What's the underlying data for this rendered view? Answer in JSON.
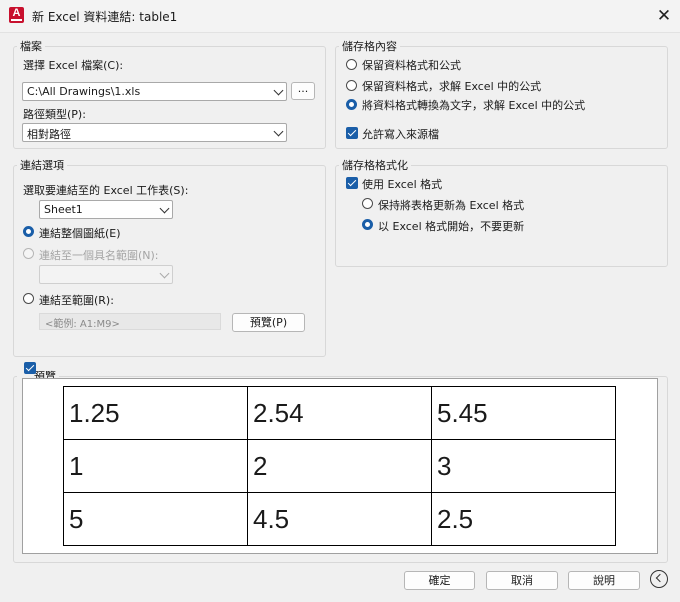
{
  "window": {
    "title": "新 Excel 資料連結: table1",
    "app_icon_letter": "A"
  },
  "file_group": {
    "legend": "檔案",
    "select_label": "選擇 Excel 檔案(C):",
    "file_value": "C:\\All Drawings\\1.xls",
    "browse_label": "...",
    "path_type_label": "路徑類型(P):",
    "path_type_value": "相對路徑"
  },
  "link_group": {
    "legend": "連結選項",
    "sheet_label": "選取要連結至的 Excel 工作表(S):",
    "sheet_value": "Sheet1",
    "opt_whole": "連結整個圖紙(E)",
    "opt_named": "連結至一個具名範圍(N):",
    "opt_range": "連結至範圍(R):",
    "range_placeholder": "<範例: A1:M9>",
    "preview_button": "預覽(P)"
  },
  "cell_contents": {
    "legend": "儲存格內容",
    "opt1": "保留資料格式和公式",
    "opt2": "保留資料格式，求解 Excel 中的公式",
    "opt3": "將資料格式轉換為文字，求解 Excel 中的公式",
    "allow_writeback": "允許寫入來源檔"
  },
  "cell_formatting": {
    "legend": "儲存格格式化",
    "use_excel": "使用 Excel 格式",
    "opt_keep": "保持將表格更新為 Excel 格式",
    "opt_start": "以 Excel 格式開始，不要更新"
  },
  "preview": {
    "legend": "預覽",
    "rows": [
      [
        "1.25",
        "2.54",
        "5.45"
      ],
      [
        "1",
        "2",
        "3"
      ],
      [
        "5",
        "4.5",
        "2.5"
      ]
    ]
  },
  "footer": {
    "ok": "確定",
    "cancel": "取消",
    "help": "說明"
  }
}
